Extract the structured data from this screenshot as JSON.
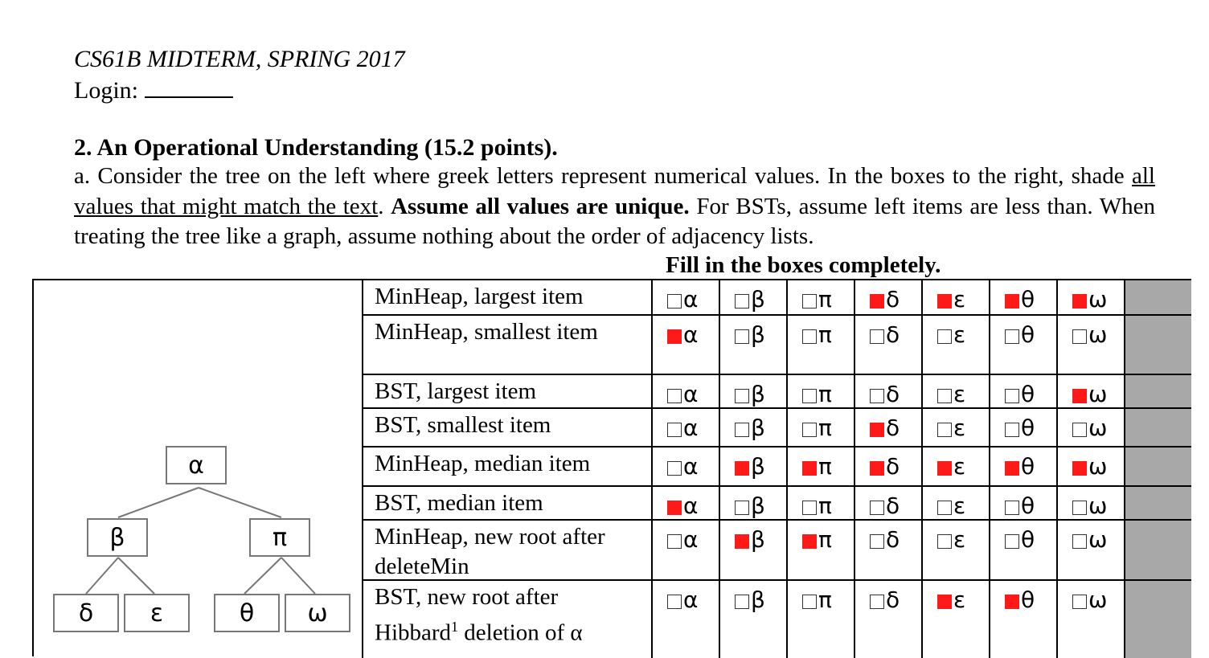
{
  "header": {
    "exam": "CS61B MIDTERM, SPRING 2017",
    "login_label": "Login:"
  },
  "question": {
    "title": "2. An Operational Understanding (15.2 points).",
    "intro_a": "a. Consider the tree on the left where greek letters represent numerical values. In the boxes to the right, shade ",
    "intro_underlined": "all values that might match the text",
    "intro_b": ". ",
    "intro_bold": "Assume all values are unique.",
    "intro_c": " For BSTs, assume left items are less than. When treating the tree like a graph, assume nothing about the order of adjacency lists.",
    "fill_instruction": "Fill in the boxes completely."
  },
  "tree": {
    "root": "α",
    "level1": [
      "β",
      "π"
    ],
    "level2": [
      "δ",
      "ε",
      "θ",
      "ω"
    ]
  },
  "colors": {
    "shaded": "#ff1a1a",
    "gray_column": "#a8a8a8",
    "tree_edge": "#777777"
  },
  "table": {
    "symbols": [
      "α",
      "β",
      "π",
      "δ",
      "ε",
      "θ",
      "ω"
    ],
    "rows": [
      {
        "label": "MinHeap, largest item",
        "shaded": [
          false,
          false,
          false,
          true,
          true,
          true,
          true
        ]
      },
      {
        "label": "MinHeap, smallest item",
        "shaded": [
          true,
          false,
          false,
          false,
          false,
          false,
          false
        ]
      },
      {
        "label": "BST, largest item",
        "shaded": [
          false,
          false,
          false,
          false,
          false,
          false,
          true
        ]
      },
      {
        "label": "BST, smallest item",
        "shaded": [
          false,
          false,
          false,
          true,
          false,
          false,
          false
        ]
      },
      {
        "label": "MinHeap, median item",
        "shaded": [
          false,
          true,
          true,
          true,
          true,
          true,
          true
        ]
      },
      {
        "label": "BST, median item",
        "shaded": [
          true,
          false,
          false,
          false,
          false,
          false,
          false
        ]
      },
      {
        "label": "MinHeap, new root after deleteMin",
        "shaded": [
          false,
          true,
          true,
          false,
          false,
          false,
          false
        ]
      },
      {
        "label": "BST, new root after Hibbard deletion of α",
        "label_pre": "BST, new root after Hibbard",
        "footnote": "1",
        "label_post": " deletion of α",
        "shaded": [
          false,
          false,
          false,
          false,
          true,
          true,
          false
        ]
      }
    ]
  }
}
